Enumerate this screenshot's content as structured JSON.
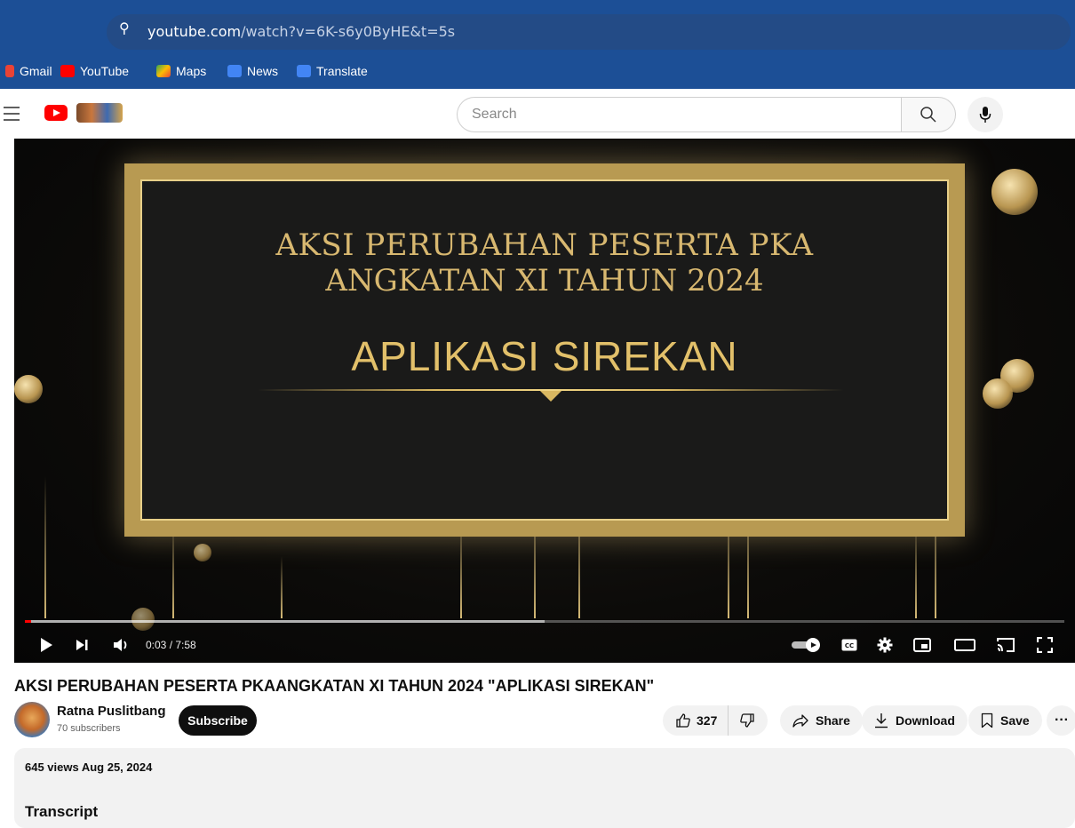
{
  "browser": {
    "url_host": "youtube.com",
    "url_rest": "/watch?v=6K-s6y0ByHE&t=5s",
    "bookmarks": [
      {
        "label": "Gmail",
        "color": "#ea4335"
      },
      {
        "label": "YouTube",
        "color": "#ff0000"
      },
      {
        "label": "Maps",
        "color": "#34a853"
      },
      {
        "label": "News",
        "color": "#4285f4"
      },
      {
        "label": "Translate",
        "color": "#4285f4"
      }
    ]
  },
  "header": {
    "search_placeholder": "Search"
  },
  "player": {
    "slide_line1": "AKSI PERUBAHAN PESERTA PKA",
    "slide_line2": "ANGKATAN XI TAHUN 2024",
    "slide_title": "APLIKASI SIREKAN",
    "time": "0:03 / 7:58",
    "progress_played": 0.006,
    "progress_buffered": 0.5
  },
  "video": {
    "title": "AKSI PERUBAHAN PESERTA PKAANGKATAN XI TAHUN 2024 \"APLIKASI SIREKAN\"",
    "channel": "Ratna Puslitbang",
    "subscribers": "70 subscribers",
    "subscribe_label": "Subscribe",
    "likes": "327",
    "share_label": "Share",
    "download_label": "Download",
    "save_label": "Save",
    "more_label": "···",
    "meta": "645 views  Aug 25, 2024",
    "transcript_label": "Transcript"
  }
}
